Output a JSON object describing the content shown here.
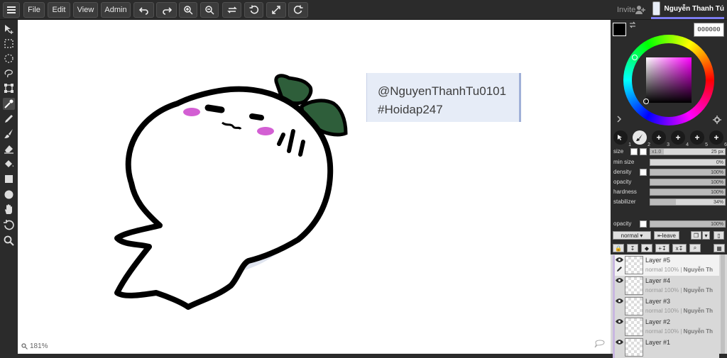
{
  "toolbar": {
    "menu_icon": "hamburger-icon",
    "file": "File",
    "edit": "Edit",
    "view": "View",
    "admin": "Admin",
    "invite": "Invite",
    "username": "Nguyễn Thanh Tú"
  },
  "canvas": {
    "text_line1": "@NguyenThanhTu0101",
    "text_line2": "#Hoidap247",
    "zoom": "181%"
  },
  "color": {
    "hex": "000000",
    "primary": "#000000",
    "secondary": "#000000"
  },
  "brushes": [
    {
      "label": "1",
      "selected": false
    },
    {
      "label": "2",
      "selected": true
    },
    {
      "label": "3",
      "selected": false
    },
    {
      "label": "4",
      "selected": false
    },
    {
      "label": "5",
      "selected": false
    },
    {
      "label": "6",
      "selected": false
    }
  ],
  "sliders": {
    "size_label": "size",
    "size_multiplier": "x1.0",
    "size_value": "25 px",
    "min_size_label": "min size",
    "min_size_value": "0%",
    "density_label": "density",
    "density_value": "100%",
    "opacity_label": "opacity",
    "opacity_value": "100%",
    "hardness_label": "hardness",
    "hardness_value": "100%",
    "stabilizer_label": "stabilizer",
    "stabilizer_value": "34%",
    "stabilizer_fraction": 0.34,
    "layer_opacity_label": "opacity",
    "layer_opacity_value": "100%"
  },
  "layer_controls": {
    "blend_mode": "normal",
    "leave": "leave"
  },
  "layers": [
    {
      "name": "Layer #5",
      "meta": "normal 100% |",
      "owner": "Nguyễn Th",
      "selected": true
    },
    {
      "name": "Layer #4",
      "meta": "normal 100% |",
      "owner": "Nguyễn Th",
      "selected": false
    },
    {
      "name": "Layer #3",
      "meta": "normal 100% |",
      "owner": "Nguyễn Th",
      "selected": false
    },
    {
      "name": "Layer #2",
      "meta": "normal 100% |",
      "owner": "Nguyễn Th",
      "selected": false
    },
    {
      "name": "Layer #1",
      "meta": "",
      "owner": "",
      "selected": false
    }
  ]
}
